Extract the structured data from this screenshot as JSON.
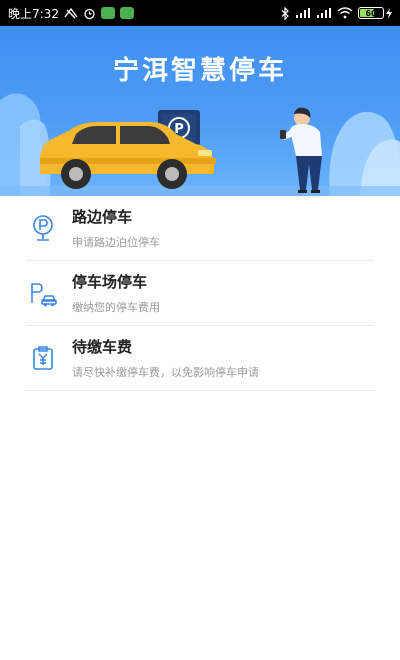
{
  "status_bar": {
    "time": "晚上7:32",
    "battery": "60",
    "icons": [
      "alarm-icon",
      "notification-icon",
      "bluetooth-icon",
      "signal-icon",
      "wifi-icon",
      "battery-icon"
    ]
  },
  "banner": {
    "title": "宁洱智慧停车",
    "parking_sign": "P"
  },
  "menu": [
    {
      "title": "路边停车",
      "subtitle": "申请路边泊位停车",
      "icon": "roadside-parking-icon"
    },
    {
      "title": "停车场停车",
      "subtitle": "缴纳您的停车费用",
      "icon": "parking-lot-icon"
    },
    {
      "title": "待缴车费",
      "subtitle": "请尽快补缴停车费，以免影响停车申请",
      "icon": "pending-fee-icon"
    }
  ],
  "colors": {
    "accent": "#3a86e0",
    "banner_top": "#3f8ff0",
    "car": "#f5b82e"
  }
}
